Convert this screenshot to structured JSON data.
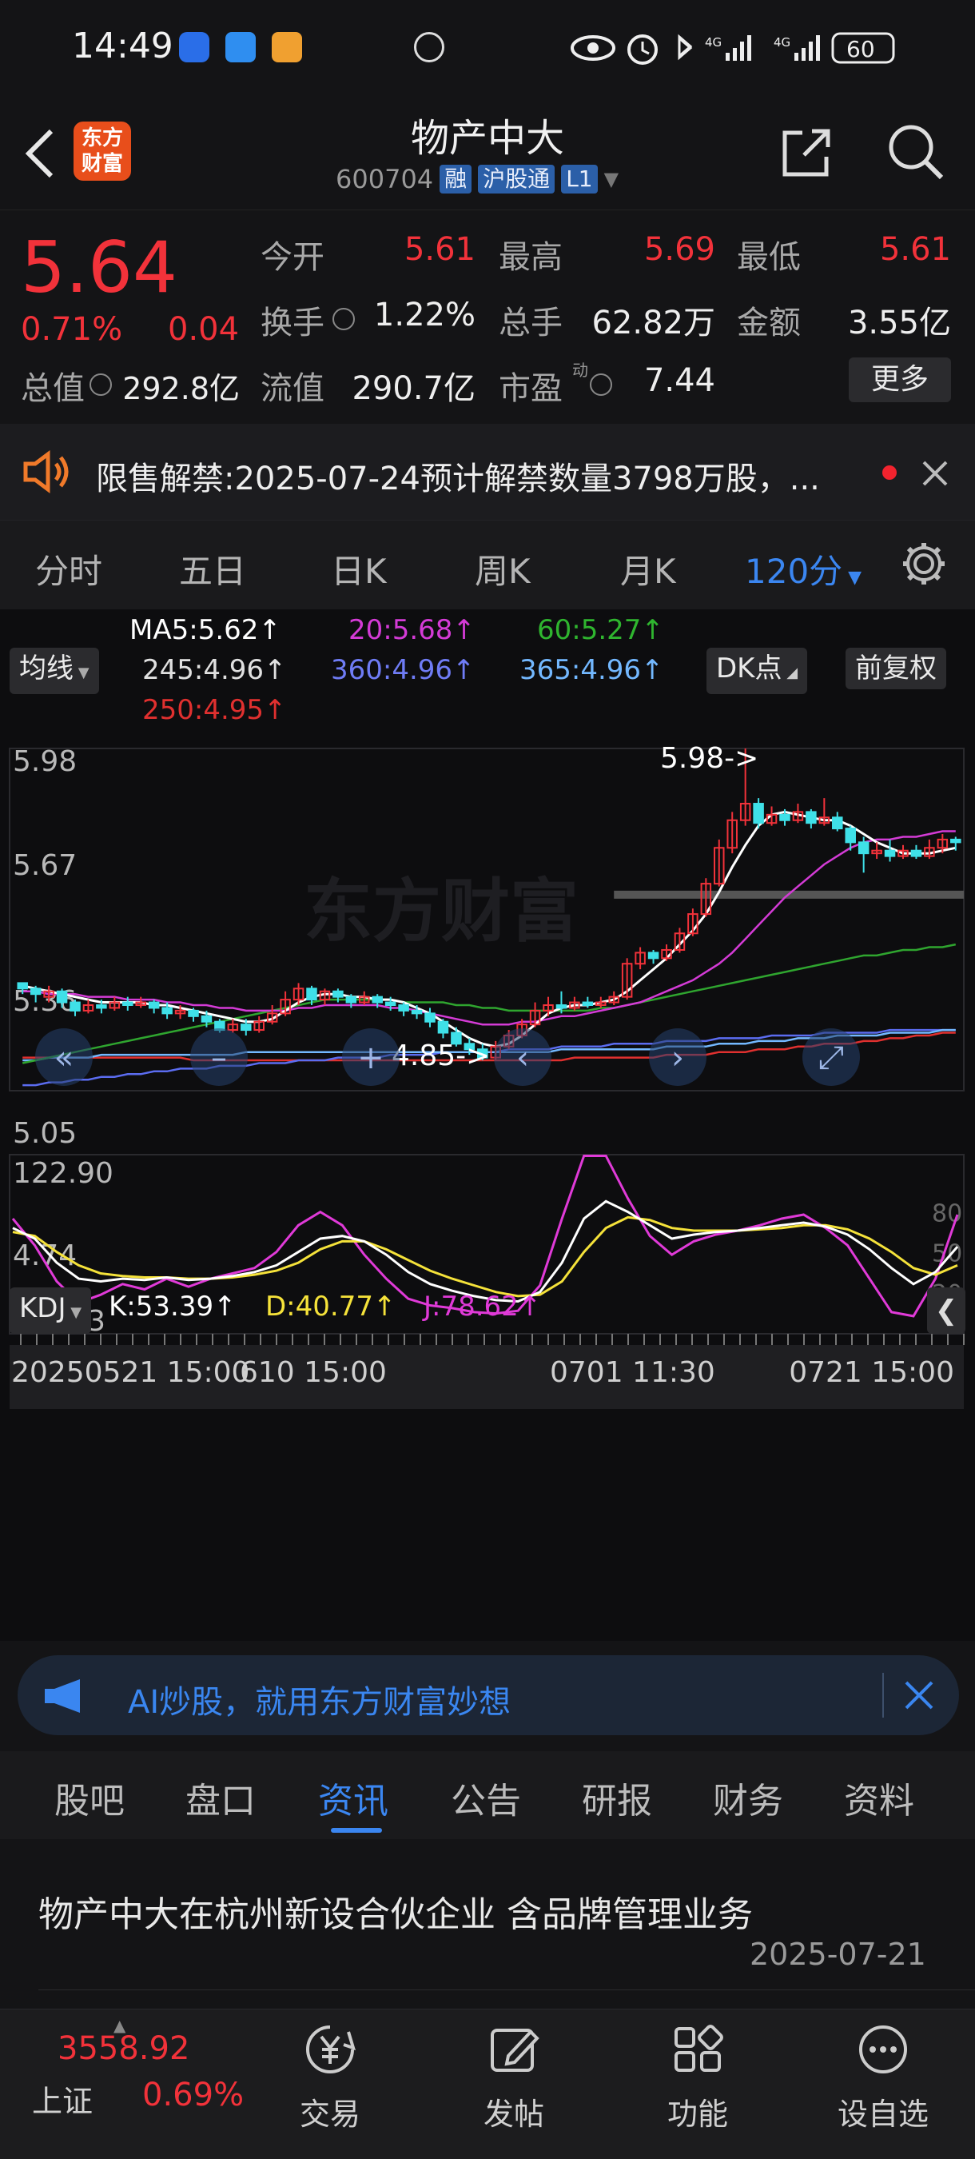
{
  "status": {
    "time": "14:49",
    "net1": "4G",
    "net2": "4G",
    "battery": "60"
  },
  "header": {
    "back_icon": "chevron-left-icon",
    "logo_text_1": "东方",
    "logo_text_2": "财富",
    "title": "物产中大",
    "code": "600704",
    "tags": [
      "融",
      "沪股通",
      "L1"
    ],
    "share_icon": "share-icon",
    "search_icon": "search-icon"
  },
  "quote": {
    "price": "5.64",
    "change_pct": "0.71%",
    "change": "0.04",
    "open_label": "今开",
    "open": "5.61",
    "high_label": "最高",
    "high": "5.69",
    "low_label": "最低",
    "low": "5.61",
    "turnover_label": "换手",
    "turnover": "1.22%",
    "volume_label": "总手",
    "volume": "62.82万",
    "amount_label": "金额",
    "amount": "3.55亿",
    "mktcap_label": "总值",
    "mktcap": "292.8亿",
    "float_label": "流值",
    "float": "290.7亿",
    "pe_label": "市盈",
    "pe_sup": "动",
    "pe": "7.44",
    "more_label": "更多"
  },
  "notice": {
    "label": "限售解禁:",
    "text": "2025-07-24预计解禁数量3798万股，..."
  },
  "period_tabs": [
    "分时",
    "五日",
    "日K",
    "周K",
    "月K",
    "120分"
  ],
  "active_period": "120分",
  "ma": {
    "selector": "均线",
    "ma5": "MA5:5.62↑",
    "ma20": "20:5.68↑",
    "ma60": "60:5.27↑",
    "ma245": "245:4.96↑",
    "ma360": "360:4.96↑",
    "ma365": "365:4.96↑",
    "ma250": "250:4.95↑",
    "dk_button": "DK点",
    "adjust_button": "前复权"
  },
  "colors": {
    "red": "#f2323a",
    "cyan": "#3fe0e8",
    "ma5": "#ffffff",
    "ma20": "#d43bd6",
    "ma60": "#2fa52f",
    "ma245": "#d8d8d8",
    "ma360": "#5b6cf0",
    "ma365": "#73b8ff",
    "ma250": "#e0302f",
    "kdj_k": "#ffffff",
    "kdj_d": "#f5e23a",
    "kdj_j": "#e03ad8"
  },
  "main_chart": {
    "price_labels": [
      "5.98",
      "5.67",
      "5.36",
      "5.05",
      "4.74"
    ],
    "ylim": [
      4.74,
      5.98
    ],
    "watermark": "东方财富",
    "max_marker": "5.98->",
    "min_marker": "4.85->",
    "candles": [
      [
        5.13,
        5.11,
        5.13,
        5.09
      ],
      [
        5.11,
        5.09,
        5.12,
        5.06
      ],
      [
        5.08,
        5.1,
        5.12,
        5.06
      ],
      [
        5.1,
        5.06,
        5.11,
        5.04
      ],
      [
        5.06,
        5.03,
        5.07,
        5.01
      ],
      [
        5.03,
        5.05,
        5.07,
        5.02
      ],
      [
        5.05,
        5.04,
        5.07,
        5.02
      ],
      [
        5.04,
        5.06,
        5.08,
        5.03
      ],
      [
        5.06,
        5.05,
        5.08,
        5.03
      ],
      [
        5.05,
        5.06,
        5.08,
        5.04
      ],
      [
        5.06,
        5.04,
        5.07,
        5.02
      ],
      [
        5.04,
        5.02,
        5.06,
        5.0
      ],
      [
        5.02,
        5.03,
        5.05,
        5.0
      ],
      [
        5.03,
        5.01,
        5.04,
        4.99
      ],
      [
        5.01,
        4.99,
        5.03,
        4.97
      ],
      [
        4.99,
        4.96,
        5.0,
        4.95
      ],
      [
        4.96,
        4.98,
        5.0,
        4.95
      ],
      [
        4.98,
        4.96,
        5.0,
        4.94
      ],
      [
        4.96,
        4.99,
        5.01,
        4.95
      ],
      [
        4.99,
        5.02,
        5.05,
        4.98
      ],
      [
        5.02,
        5.07,
        5.1,
        5.01
      ],
      [
        5.07,
        5.11,
        5.13,
        5.05
      ],
      [
        5.11,
        5.07,
        5.12,
        5.05
      ],
      [
        5.07,
        5.1,
        5.11,
        5.05
      ],
      [
        5.1,
        5.08,
        5.11,
        5.06
      ],
      [
        5.08,
        5.06,
        5.09,
        5.04
      ],
      [
        5.06,
        5.08,
        5.1,
        5.05
      ],
      [
        5.08,
        5.06,
        5.09,
        5.04
      ],
      [
        5.06,
        5.05,
        5.08,
        5.03
      ],
      [
        5.05,
        5.03,
        5.06,
        5.01
      ],
      [
        5.03,
        5.02,
        5.05,
        5.0
      ],
      [
        5.02,
        4.99,
        5.04,
        4.97
      ],
      [
        4.99,
        4.95,
        5.0,
        4.93
      ],
      [
        4.95,
        4.91,
        4.97,
        4.9
      ],
      [
        4.91,
        4.89,
        4.93,
        4.87
      ],
      [
        4.89,
        4.86,
        4.91,
        4.85
      ],
      [
        4.86,
        4.9,
        4.92,
        4.85
      ],
      [
        4.9,
        4.94,
        4.96,
        4.89
      ],
      [
        4.94,
        4.98,
        5.0,
        4.93
      ],
      [
        4.98,
        5.03,
        5.06,
        4.97
      ],
      [
        5.03,
        5.05,
        5.08,
        5.01
      ],
      [
        5.05,
        5.04,
        5.1,
        5.02
      ],
      [
        5.04,
        5.06,
        5.08,
        5.03
      ],
      [
        5.06,
        5.05,
        5.08,
        5.04
      ],
      [
        5.05,
        5.06,
        5.08,
        5.04
      ],
      [
        5.06,
        5.08,
        5.1,
        5.05
      ],
      [
        5.08,
        5.2,
        5.22,
        5.07
      ],
      [
        5.2,
        5.24,
        5.26,
        5.18
      ],
      [
        5.24,
        5.22,
        5.25,
        5.2
      ],
      [
        5.22,
        5.25,
        5.27,
        5.21
      ],
      [
        5.25,
        5.31,
        5.33,
        5.24
      ],
      [
        5.31,
        5.38,
        5.4,
        5.3
      ],
      [
        5.38,
        5.49,
        5.51,
        5.37
      ],
      [
        5.49,
        5.62,
        5.65,
        5.48
      ],
      [
        5.62,
        5.72,
        5.75,
        5.6
      ],
      [
        5.72,
        5.78,
        5.98,
        5.7
      ],
      [
        5.78,
        5.71,
        5.8,
        5.69
      ],
      [
        5.71,
        5.74,
        5.77,
        5.7
      ],
      [
        5.74,
        5.72,
        5.76,
        5.7
      ],
      [
        5.72,
        5.75,
        5.78,
        5.71
      ],
      [
        5.75,
        5.71,
        5.76,
        5.69
      ],
      [
        5.71,
        5.73,
        5.8,
        5.7
      ],
      [
        5.73,
        5.69,
        5.75,
        5.68
      ],
      [
        5.69,
        5.64,
        5.7,
        5.61
      ],
      [
        5.64,
        5.6,
        5.66,
        5.53
      ],
      [
        5.6,
        5.61,
        5.64,
        5.58
      ],
      [
        5.61,
        5.59,
        5.65,
        5.57
      ],
      [
        5.59,
        5.61,
        5.63,
        5.58
      ],
      [
        5.61,
        5.59,
        5.63,
        5.58
      ],
      [
        5.59,
        5.62,
        5.65,
        5.58
      ],
      [
        5.62,
        5.65,
        5.67,
        5.6
      ],
      [
        5.65,
        5.64,
        5.66,
        5.61
      ]
    ],
    "lines": {
      "ma5": [
        5.12,
        5.11,
        5.1,
        5.09,
        5.08,
        5.07,
        5.06,
        5.06,
        5.06,
        5.06,
        5.05,
        5.05,
        5.04,
        5.03,
        5.02,
        5.01,
        5.0,
        4.99,
        4.99,
        5.0,
        5.03,
        5.06,
        5.08,
        5.09,
        5.09,
        5.08,
        5.08,
        5.07,
        5.07,
        5.06,
        5.04,
        5.02,
        4.99,
        4.96,
        4.93,
        4.91,
        4.9,
        4.91,
        4.94,
        4.98,
        5.02,
        5.04,
        5.05,
        5.05,
        5.06,
        5.07,
        5.1,
        5.14,
        5.18,
        5.22,
        5.27,
        5.32,
        5.38,
        5.46,
        5.55,
        5.63,
        5.7,
        5.74,
        5.75,
        5.74,
        5.73,
        5.72,
        5.72,
        5.7,
        5.67,
        5.64,
        5.62,
        5.6,
        5.6,
        5.6,
        5.61,
        5.62
      ],
      "ma20": [
        5.1,
        5.1,
        5.09,
        5.09,
        5.09,
        5.08,
        5.08,
        5.08,
        5.07,
        5.07,
        5.07,
        5.06,
        5.06,
        5.05,
        5.05,
        5.04,
        5.04,
        5.03,
        5.03,
        5.03,
        5.03,
        5.04,
        5.04,
        5.05,
        5.05,
        5.05,
        5.05,
        5.05,
        5.04,
        5.04,
        5.03,
        5.02,
        5.01,
        5.0,
        4.99,
        4.98,
        4.98,
        4.98,
        4.99,
        4.99,
        5.0,
        5.01,
        5.01,
        5.02,
        5.03,
        5.04,
        5.05,
        5.06,
        5.08,
        5.1,
        5.12,
        5.14,
        5.17,
        5.2,
        5.24,
        5.29,
        5.34,
        5.39,
        5.44,
        5.48,
        5.52,
        5.56,
        5.59,
        5.62,
        5.64,
        5.65,
        5.65,
        5.66,
        5.66,
        5.67,
        5.68,
        5.68
      ],
      "ma60": [
        4.84,
        4.85,
        4.86,
        4.87,
        4.88,
        4.89,
        4.9,
        4.91,
        4.92,
        4.93,
        4.94,
        4.95,
        4.96,
        4.97,
        4.98,
        4.99,
        5.0,
        5.01,
        5.02,
        5.03,
        5.04,
        5.05,
        5.06,
        5.07,
        5.07,
        5.07,
        5.07,
        5.07,
        5.07,
        5.06,
        5.06,
        5.06,
        5.06,
        5.05,
        5.05,
        5.04,
        5.04,
        5.03,
        5.03,
        5.03,
        5.03,
        5.03,
        5.03,
        5.03,
        5.04,
        5.04,
        5.05,
        5.06,
        5.07,
        5.08,
        5.09,
        5.1,
        5.11,
        5.12,
        5.13,
        5.14,
        5.15,
        5.16,
        5.17,
        5.18,
        5.19,
        5.2,
        5.21,
        5.22,
        5.23,
        5.23,
        5.24,
        5.25,
        5.25,
        5.26,
        5.26,
        5.27
      ],
      "ma245": [
        4.85,
        4.85,
        4.86,
        4.86,
        4.86,
        4.86,
        4.87,
        4.87,
        4.87,
        4.87,
        4.87,
        4.87,
        4.87,
        4.87,
        4.87,
        4.87,
        4.87,
        4.88,
        4.88,
        4.88,
        4.88,
        4.88,
        4.88,
        4.88,
        4.88,
        4.88,
        4.88,
        4.88,
        4.88,
        4.88,
        4.88,
        4.88,
        4.88,
        4.88,
        4.88,
        4.88,
        4.88,
        4.88,
        4.88,
        4.88,
        4.88,
        4.89,
        4.89,
        4.89,
        4.89,
        4.89,
        4.89,
        4.89,
        4.89,
        4.9,
        4.9,
        4.9,
        4.9,
        4.91,
        4.91,
        4.91,
        4.92,
        4.92,
        4.92,
        4.93,
        4.93,
        4.93,
        4.94,
        4.94,
        4.94,
        4.94,
        4.95,
        4.95,
        4.95,
        4.95,
        4.96,
        4.96
      ],
      "ma360": [
        4.76,
        4.76,
        4.77,
        4.77,
        4.78,
        4.78,
        4.79,
        4.79,
        4.8,
        4.8,
        4.81,
        4.81,
        4.82,
        4.82,
        4.82,
        4.83,
        4.83,
        4.83,
        4.84,
        4.84,
        4.84,
        4.85,
        4.85,
        4.85,
        4.86,
        4.86,
        4.86,
        4.86,
        4.87,
        4.87,
        4.87,
        4.87,
        4.88,
        4.88,
        4.88,
        4.88,
        4.88,
        4.89,
        4.89,
        4.89,
        4.89,
        4.9,
        4.9,
        4.9,
        4.9,
        4.91,
        4.91,
        4.91,
        4.91,
        4.92,
        4.92,
        4.92,
        4.92,
        4.93,
        4.93,
        4.93,
        4.93,
        4.94,
        4.94,
        4.94,
        4.94,
        4.95,
        4.95,
        4.95,
        4.95,
        4.95,
        4.96,
        4.96,
        4.96,
        4.96,
        4.96,
        4.96
      ],
      "ma250": [
        4.86,
        4.86,
        4.86,
        4.86,
        4.86,
        4.86,
        4.86,
        4.86,
        4.86,
        4.86,
        4.86,
        4.86,
        4.86,
        4.85,
        4.85,
        4.85,
        4.85,
        4.85,
        4.85,
        4.85,
        4.85,
        4.85,
        4.85,
        4.85,
        4.85,
        4.85,
        4.85,
        4.85,
        4.85,
        4.85,
        4.85,
        4.85,
        4.85,
        4.85,
        4.85,
        4.85,
        4.85,
        4.85,
        4.85,
        4.85,
        4.85,
        4.85,
        4.86,
        4.86,
        4.86,
        4.86,
        4.86,
        4.86,
        4.86,
        4.87,
        4.87,
        4.87,
        4.87,
        4.88,
        4.88,
        4.88,
        4.89,
        4.89,
        4.89,
        4.9,
        4.9,
        4.91,
        4.91,
        4.91,
        4.92,
        4.92,
        4.93,
        4.93,
        4.94,
        4.94,
        4.95,
        4.95
      ]
    },
    "highlight_level": 5.45
  },
  "kdj": {
    "selector": "KDJ",
    "k": "K:53.39↑",
    "d": "D:40.77↑",
    "j": "J:78.62↑",
    "labels": [
      "122.90",
      "-11.23"
    ],
    "right_labels": [
      "80",
      "50",
      "20"
    ],
    "ylim": [
      -11.23,
      122.9
    ],
    "K": [
      68,
      60,
      42,
      30,
      28,
      30,
      29,
      31,
      29,
      30,
      32,
      35,
      40,
      50,
      60,
      62,
      58,
      48,
      35,
      26,
      21,
      17,
      14,
      13,
      20,
      42,
      75,
      88,
      80,
      70,
      60,
      63,
      65,
      66,
      68,
      70,
      72,
      69,
      63,
      52,
      38,
      26,
      35,
      54
    ],
    "D": [
      65,
      62,
      50,
      40,
      34,
      32,
      31,
      31,
      30,
      30,
      31,
      33,
      36,
      42,
      52,
      58,
      58,
      52,
      44,
      36,
      30,
      25,
      20,
      17,
      18,
      28,
      50,
      68,
      76,
      74,
      68,
      66,
      66,
      66,
      67,
      68,
      70,
      70,
      67,
      60,
      50,
      38,
      33,
      40
    ],
    "J": [
      75,
      55,
      28,
      12,
      18,
      26,
      22,
      30,
      24,
      30,
      34,
      38,
      50,
      70,
      80,
      70,
      48,
      30,
      15,
      10,
      8,
      5,
      4,
      6,
      25,
      75,
      122,
      122,
      90,
      62,
      48,
      58,
      63,
      66,
      70,
      75,
      78,
      68,
      55,
      30,
      5,
      2,
      30,
      78
    ]
  },
  "xaxis": {
    "left": "20250521 15:00",
    "mid1": "610 15:00",
    "mid2": "0701 11:30",
    "right": "0721 15:00"
  },
  "ai_banner": {
    "text": "AI炒股，就用东方财富妙想"
  },
  "sub_tabs": [
    "股吧",
    "盘口",
    "资讯",
    "公告",
    "研报",
    "财务",
    "资料"
  ],
  "active_sub_tab": "资讯",
  "news": [
    {
      "title": "物产中大在杭州新设合伙企业 含品牌管理业务",
      "date": "2025-07-21"
    }
  ],
  "bottom": {
    "index_value": "3558.92",
    "index_name": "上证",
    "index_change": "0.69%",
    "items": [
      {
        "label": "交易",
        "icon": "yen-icon"
      },
      {
        "label": "发帖",
        "icon": "edit-icon"
      },
      {
        "label": "功能",
        "icon": "grid-icon"
      },
      {
        "label": "设自选",
        "icon": "more-icon"
      }
    ]
  }
}
